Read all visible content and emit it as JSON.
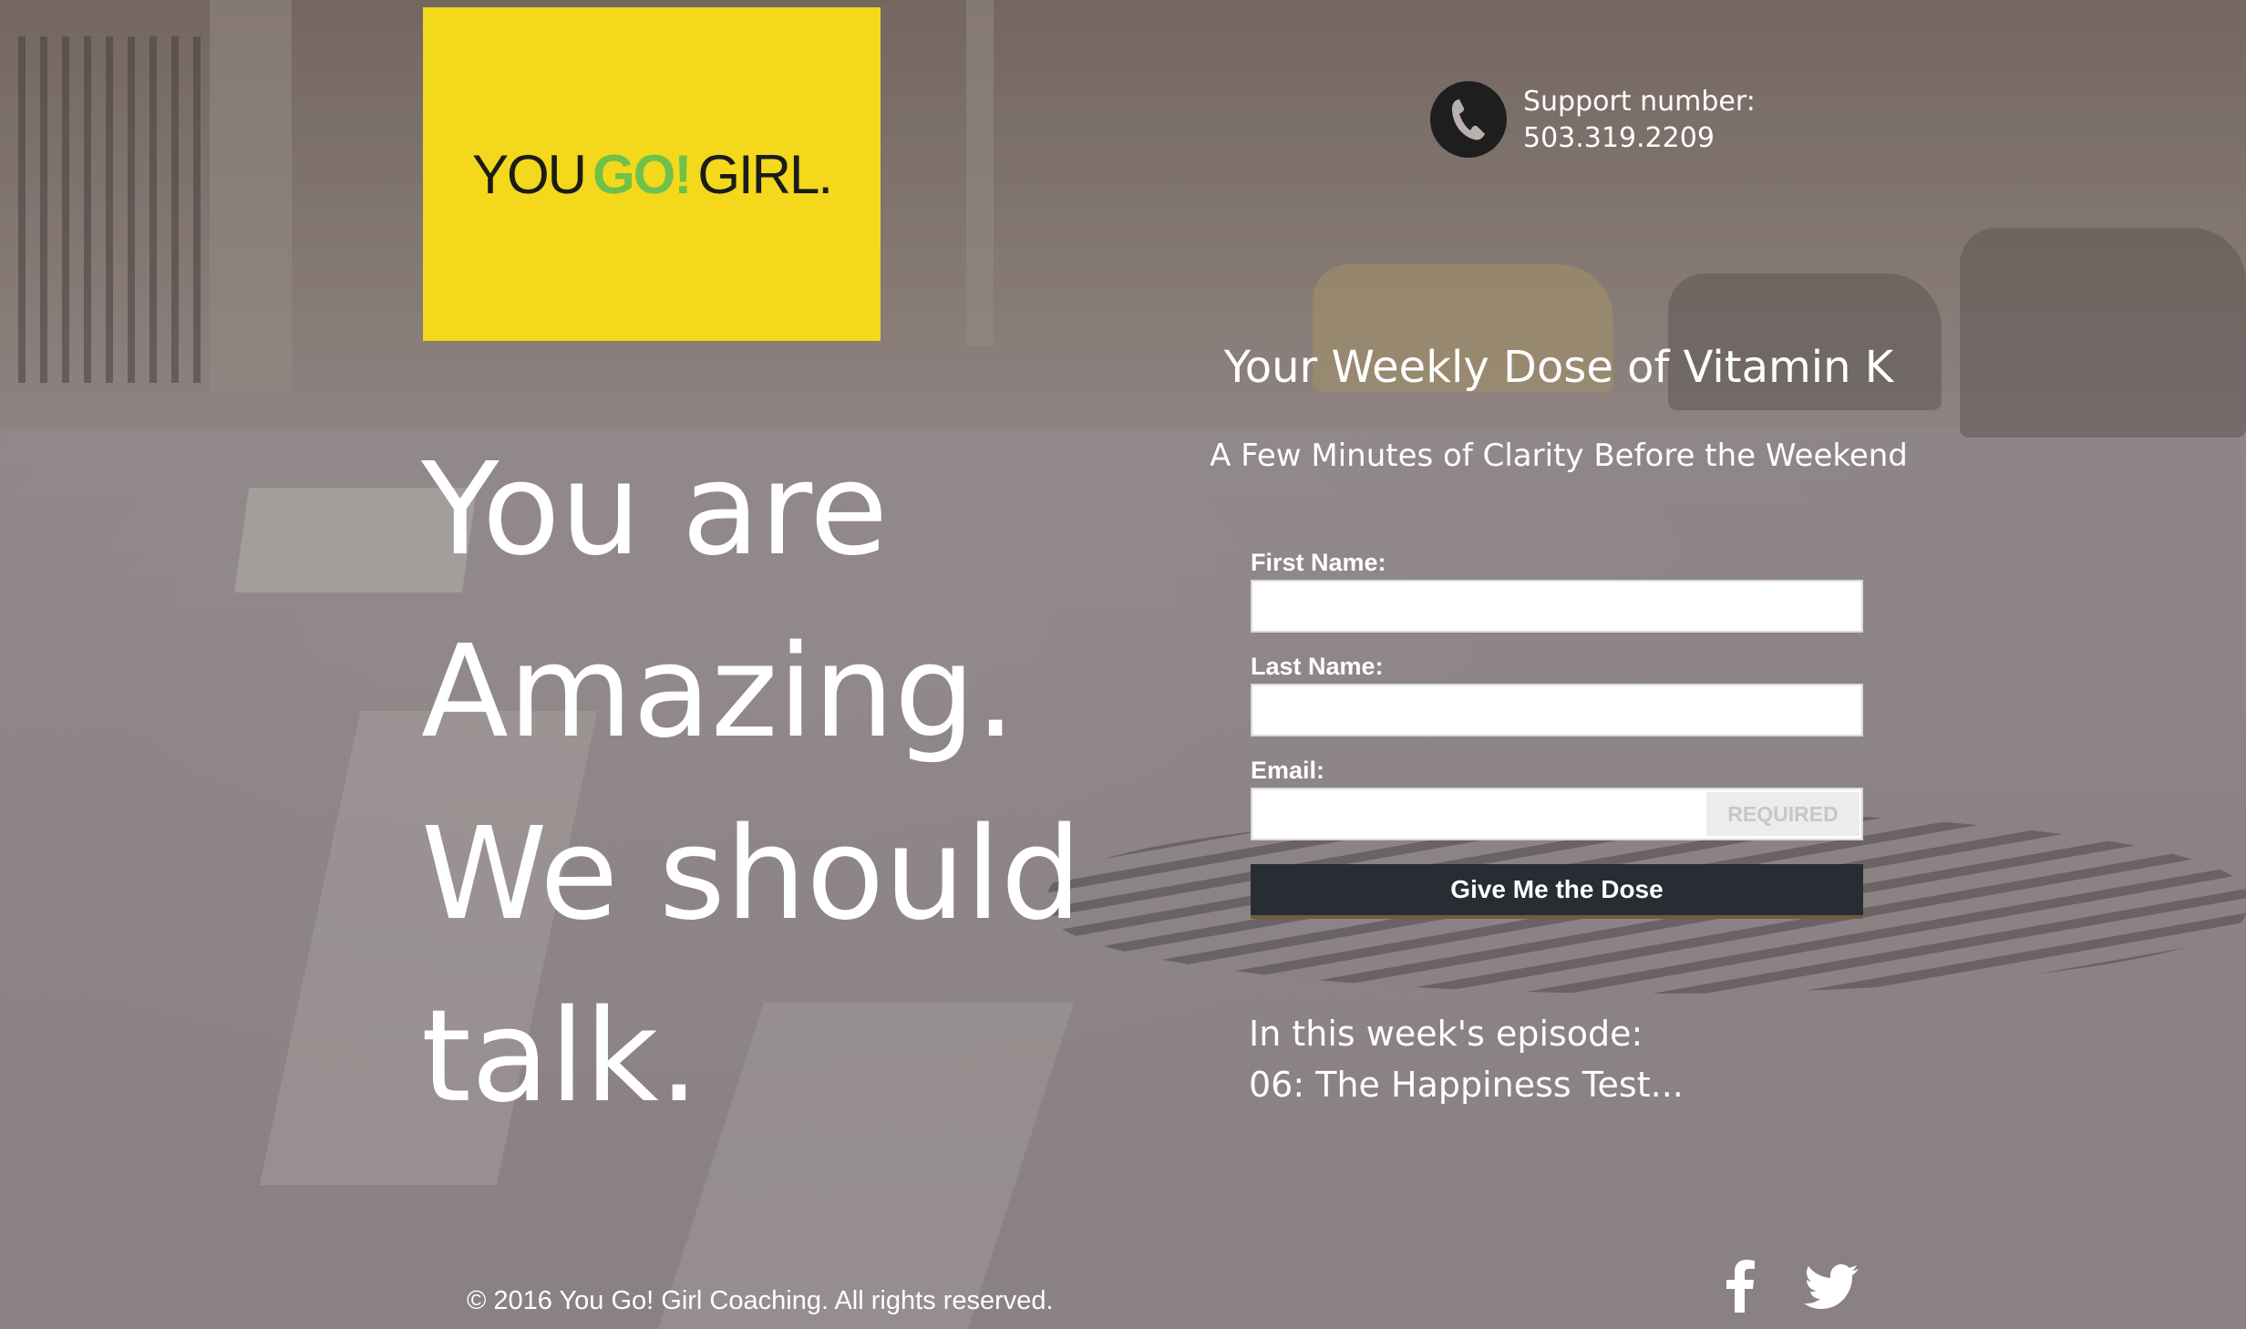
{
  "brand": {
    "logo_text_before": "YOU",
    "logo_text_go": "GO!",
    "logo_text_after": "GIRL.",
    "logo_bg_color": "#f3d81b",
    "logo_accent_color": "#6fc14b"
  },
  "support": {
    "label": "Support number:",
    "number": "503.319.2209",
    "icon": "phone-icon"
  },
  "hero": {
    "line1": "You are",
    "line2": "Amazing.",
    "line3": "We should",
    "line4": "talk."
  },
  "newsletter": {
    "title": "Your Weekly Dose of Vitamin K",
    "subtitle": "A Few Minutes of Clarity Before the Weekend",
    "first_name_label": "First Name:",
    "first_name_value": "",
    "last_name_label": "Last Name:",
    "last_name_value": "",
    "email_label": "Email:",
    "email_value": "",
    "email_required_badge": "REQUIRED",
    "submit_label": "Give Me the Dose",
    "submit_color": "#272d33"
  },
  "episode": {
    "intro": "In this week's episode:",
    "title": "06: The Happiness Test..."
  },
  "footer": {
    "copyright": "© 2016 You Go! Girl Coaching. All rights reserved.",
    "social_icons": [
      "facebook-icon",
      "twitter-icon"
    ]
  }
}
